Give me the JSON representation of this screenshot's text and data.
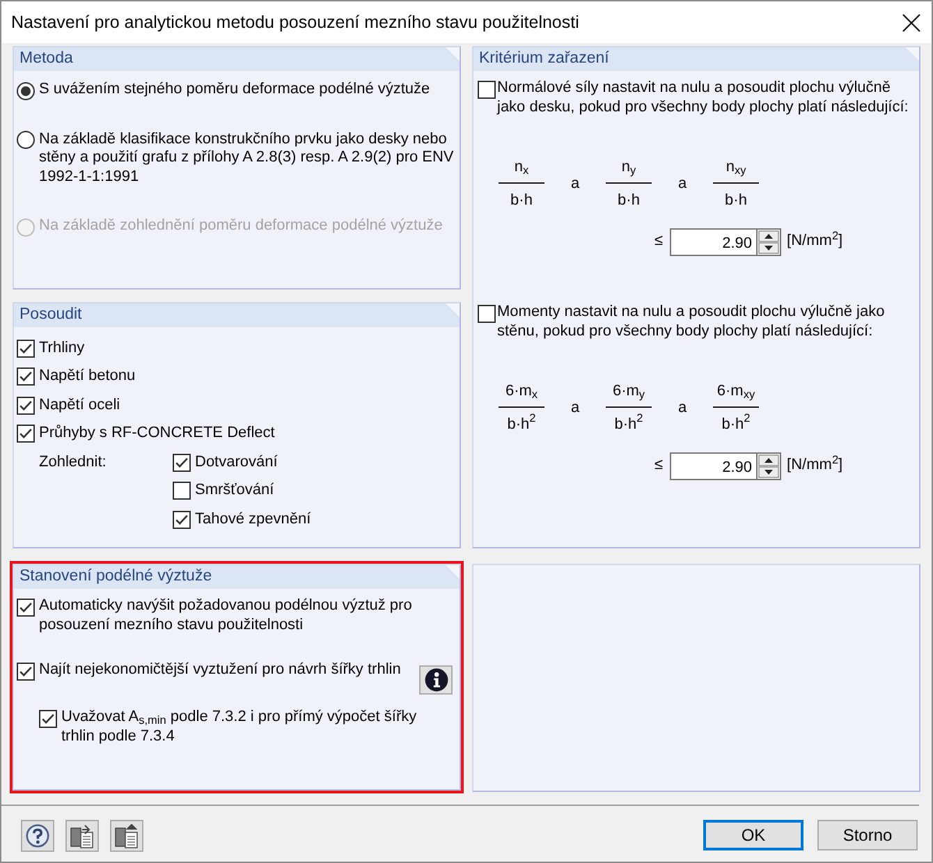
{
  "window": {
    "title": "Nastavení pro analytickou metodu posouzení mezního stavu použitelnosti"
  },
  "metoda": {
    "title": "Metoda",
    "options": [
      {
        "label": "S uvážením stejného poměru deformace podélné výztuže",
        "selected": true,
        "disabled": false
      },
      {
        "label": "Na základě klasifikace konstrukčního prvku jako desky nebo stěny a použití grafu z přílohy A 2.8(3) resp. A 2.9(2) pro ENV 1992-1-1:1991",
        "selected": false,
        "disabled": false
      },
      {
        "label": "Na základě zohlednění poměru deformace podélné výztuže",
        "selected": false,
        "disabled": true
      }
    ]
  },
  "kriterium": {
    "title": "Kritérium zařazení",
    "criteria": [
      {
        "label": "Normálové síly nastavit na nulu a posoudit plochu výlučně jako desku, pokud pro všechny body plochy platí následující:",
        "checked": false,
        "terms": [
          {
            "numerator": "n$_{x}$",
            "denominator": "b·h"
          },
          {
            "numerator": "n$_{y}$",
            "denominator": "b·h"
          },
          {
            "numerator": "n$_{xy}$",
            "denominator": "b·h"
          }
        ],
        "conjunctions": [
          "a",
          "a"
        ],
        "relation": "≤",
        "value": "2.90",
        "unit": "[N/mm$^{2}$]"
      },
      {
        "label": "Momenty nastavit na nulu a posoudit plochu výlučně jako stěnu, pokud pro všechny body plochy platí následující:",
        "checked": false,
        "terms": [
          {
            "numerator": "6·m$_{x}$",
            "denominator": "b·h$^{2}$"
          },
          {
            "numerator": "6·m$_{y}$",
            "denominator": "b·h$^{2}$"
          },
          {
            "numerator": "6·m$_{xy}$",
            "denominator": "b·h$^{2}$"
          }
        ],
        "conjunctions": [
          "a",
          "a"
        ],
        "relation": "≤",
        "value": "2.90",
        "unit": "[N/mm$^{2}$]"
      }
    ]
  },
  "posoudit": {
    "title": "Posoudit",
    "items": [
      {
        "label": "Trhliny",
        "checked": true
      },
      {
        "label": "Napětí betonu",
        "checked": true
      },
      {
        "label": "Napětí oceli",
        "checked": true
      },
      {
        "label": "Průhyby s RF-CONCRETE Deflect",
        "checked": true
      }
    ],
    "consider": {
      "label": "Zohlednit:",
      "items": [
        {
          "label": "Dotvarování",
          "checked": true
        },
        {
          "label": "Smršťování",
          "checked": false
        },
        {
          "label": "Tahové zpevnění",
          "checked": true
        }
      ]
    }
  },
  "vyztuz": {
    "title": "Stanovení podélné výztuže",
    "highlighted": true,
    "items": [
      {
        "label": "Automaticky navýšit požadovanou podélnou výztuž pro posouzení mezního stavu použitelnosti",
        "checked": true,
        "info": false
      },
      {
        "label": "Najít nejekonomičtější vyztužení pro návrh šířky trhlin",
        "checked": true,
        "info": true,
        "children": [
          {
            "label": "Uvažovat A$_{s,min}$ podle 7.3.2 i pro přímý výpočet šířky trhlin podle 7.3.4",
            "checked": true,
            "info": false
          }
        ]
      }
    ]
  },
  "buttons": [
    {
      "label": "OK",
      "default": true
    },
    {
      "label": "Storno",
      "default": false
    }
  ]
}
